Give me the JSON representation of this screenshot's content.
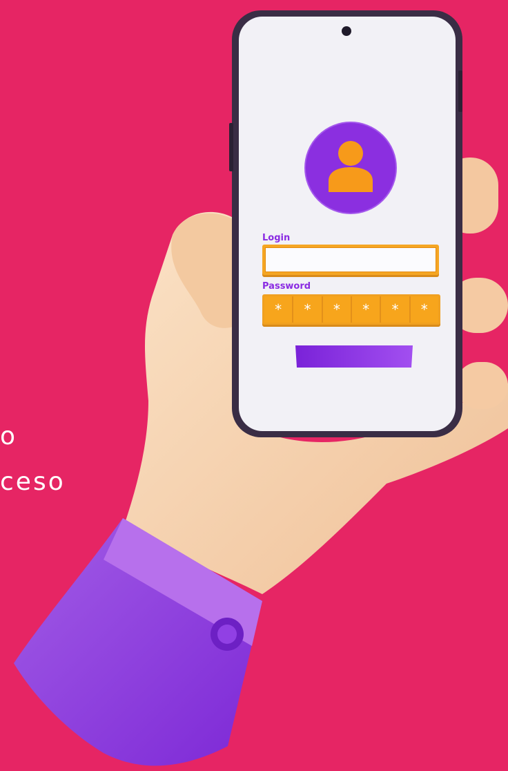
{
  "side_text": {
    "line1": "o",
    "line2": "ceso"
  },
  "login_form": {
    "login_label": "Login",
    "password_label": "Password",
    "password_mask": [
      "*",
      "*",
      "*",
      "*",
      "*",
      "*"
    ]
  },
  "colors": {
    "background": "#e62564",
    "accent_purple": "#8a2be2",
    "accent_orange": "#f5a623",
    "skin": "#f6cfa9"
  },
  "icons": [
    "user-avatar-icon",
    "cuff-button-icon"
  ]
}
